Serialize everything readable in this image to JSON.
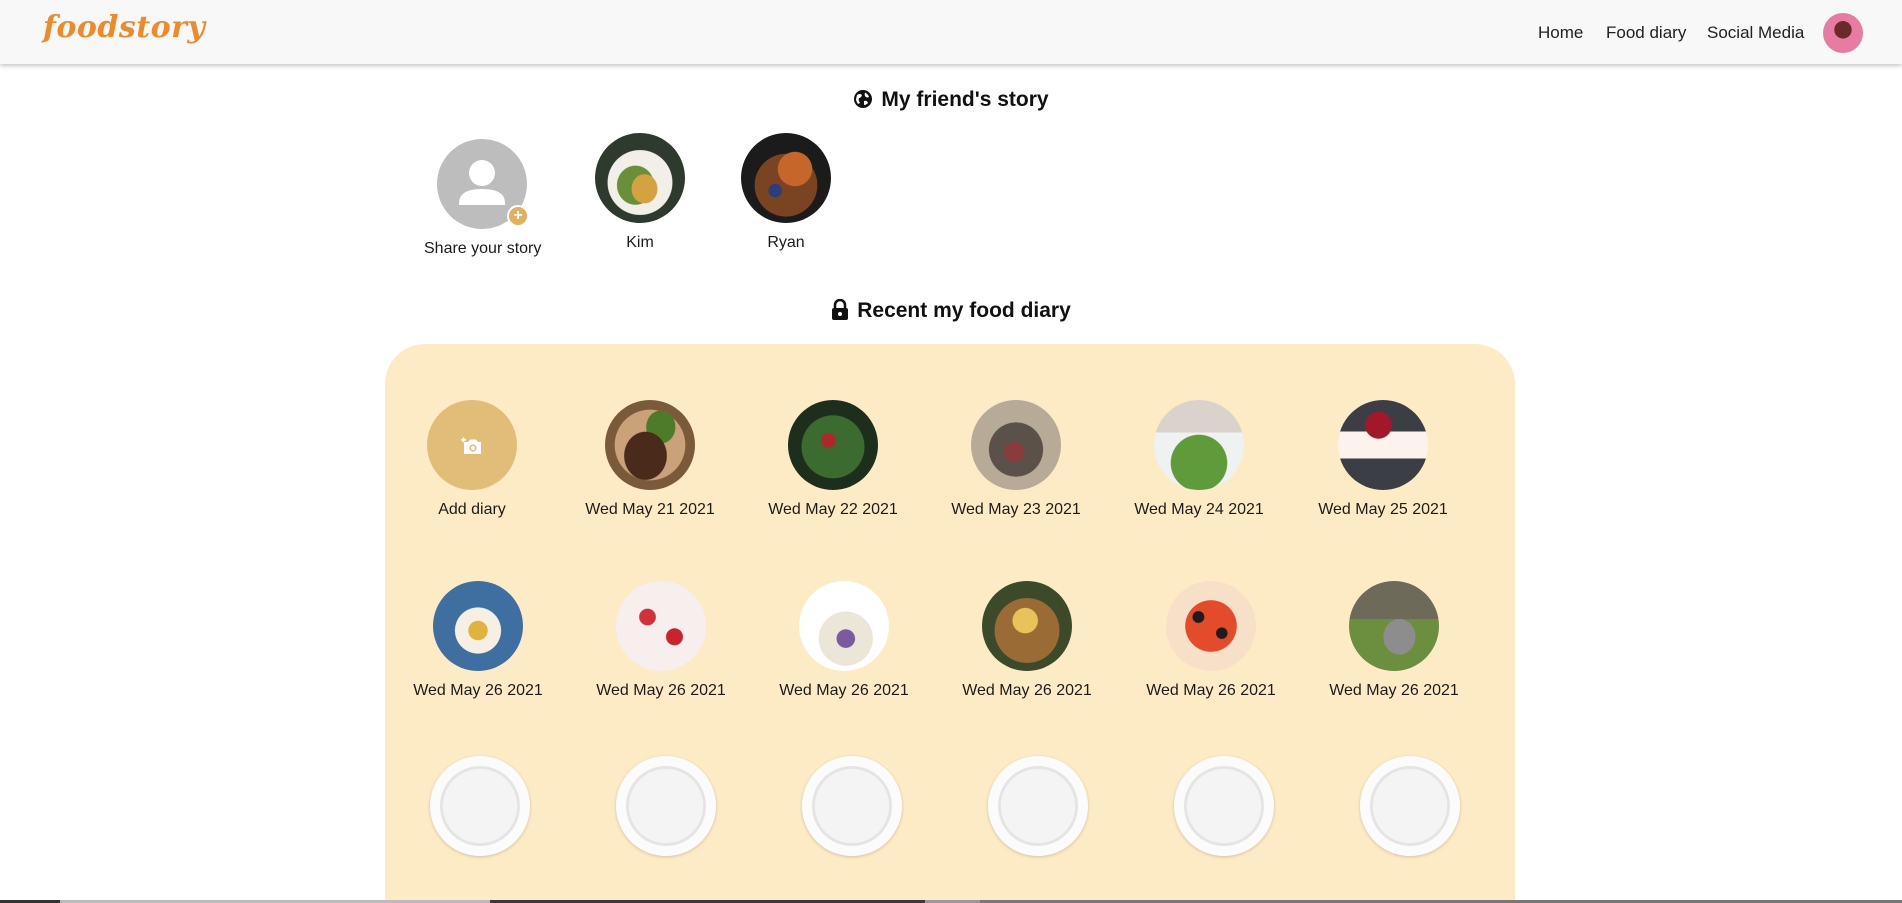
{
  "navbar": {
    "brand": "foodstory",
    "links": [
      "Home",
      "Food diary",
      "Social Media"
    ]
  },
  "friends_section": {
    "title": "My friend's story",
    "stories": [
      {
        "label": "Share your story"
      },
      {
        "label": "Kim"
      },
      {
        "label": "Ryan"
      }
    ]
  },
  "diary_section": {
    "title": "Recent my food diary",
    "add_label": "Add diary",
    "entries": [
      {
        "date": "Wed May 21 2021"
      },
      {
        "date": "Wed May 22 2021"
      },
      {
        "date": "Wed May 23 2021"
      },
      {
        "date": "Wed May 24 2021"
      },
      {
        "date": "Wed May 25 2021"
      },
      {
        "date": "Wed May 26 2021"
      },
      {
        "date": "Wed May 26 2021"
      },
      {
        "date": "Wed May 26 2021"
      },
      {
        "date": "Wed May 26 2021"
      },
      {
        "date": "Wed May 26 2021"
      },
      {
        "date": "Wed May 26 2021"
      }
    ],
    "empty_plates": 6
  },
  "colors": {
    "brand": "#ef8a2a",
    "panel": "#fdebc5",
    "add_button": "#e2bd78"
  }
}
